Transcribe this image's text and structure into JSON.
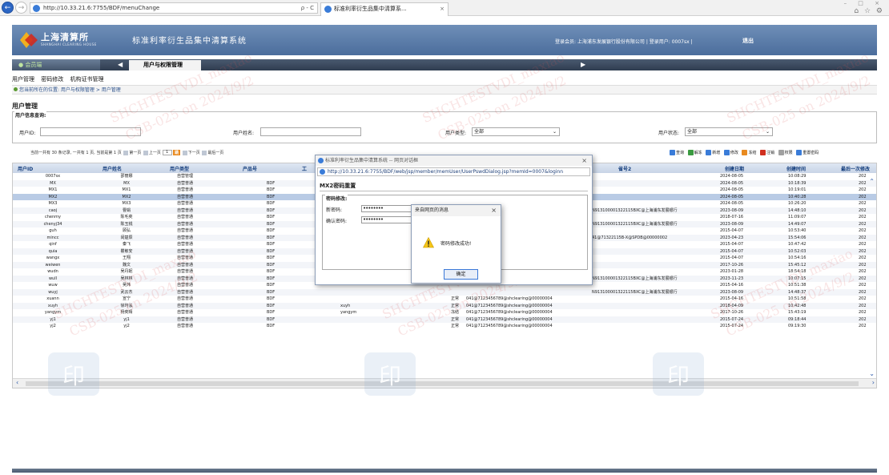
{
  "browser": {
    "url": "http://10.33.21.6:7755/BDF/menuChange",
    "address_tools": "ρ - C",
    "tab_title": "标准利率衍生品集中清算系...",
    "tab_close": "×",
    "back": "←",
    "forward": "→",
    "window_controls": "– □ ×",
    "toolbar_icons": "⌂ ☆ ⚙"
  },
  "header": {
    "logo_text": "上海清算所",
    "logo_sub": "SHANGHAI CLEARING HOUSE",
    "system_title": "标准利率衍生品集中清算系统",
    "login_info": "登录会员: 上海浦东发展银行股份有限公司 | 登录用户: 0007sx |",
    "logout": "退出"
  },
  "nav": {
    "member_label": "会员端",
    "toggle": "◀",
    "active_tab": "用户与权限管理",
    "arrow": "▶"
  },
  "menu": {
    "items": [
      "用户管理",
      "密码修改",
      "机构证书管理"
    ]
  },
  "breadcrumb": "您当前所在的位置: 用户与权限管理 > 用户管理",
  "page_title": "用户管理",
  "query": {
    "legend": "用户信息查询:",
    "user_id_label": "用户ID:",
    "user_name_label": "用户姓名:",
    "user_type_label": "用户类型:",
    "user_type_value": "全部",
    "user_status_label": "用户状态:",
    "user_status_value": "全部"
  },
  "pager": {
    "text_a": "当前一共有",
    "total": "30",
    "text_b": "条记录, 一共有",
    "pages": "1",
    "text_c": "页, 当前是第",
    "current": "1",
    "text_d": "页",
    "first": "第一页",
    "prev": "上一页",
    "page_input": "1",
    "go": "跳",
    "next": "下一页",
    "last": "最后一页"
  },
  "toolbar": {
    "items": [
      "查询",
      "解冻",
      "新增",
      "修改",
      "冻结",
      "注销",
      "权限",
      "重置密码"
    ],
    "colors": [
      "#3a7cd8",
      "#3a9a40",
      "#3a7cd8",
      "#3a7cd8",
      "#e88a20",
      "#d03020",
      "#a0a0a0",
      "#3a7cd8"
    ]
  },
  "table": {
    "headers": [
      "用户ID",
      "用户姓名",
      "用户类型",
      "产品号",
      "工",
      "省号2",
      "创建日期",
      "创建时间",
      "最后一次修改"
    ],
    "selected_index": 3,
    "rows": [
      {
        "id": "0007sx",
        "name": "邵丽娜",
        "type": "自营管理",
        "product": "",
        "col5": "",
        "status": "",
        "cert": "",
        "acct": "",
        "date": "2024-08-05",
        "time": "10:08:29",
        "last": "202"
      },
      {
        "id": "MX",
        "name": "MX",
        "type": "自营普通",
        "product": "BDF",
        "col5": "",
        "status": "",
        "cert": "",
        "acct": "",
        "date": "2024-08-05",
        "time": "10:18:39",
        "last": "202"
      },
      {
        "id": "MX1",
        "name": "MX1",
        "type": "自营普通",
        "product": "BDF",
        "col5": "",
        "status": "",
        "cert": "",
        "acct": "",
        "date": "2024-08-05",
        "time": "10:19:01",
        "last": "202"
      },
      {
        "id": "MX2",
        "name": "MX2",
        "type": "自营普通",
        "product": "BDF",
        "col5": "",
        "status": "",
        "cert": "",
        "acct": "",
        "date": "2024-08-05",
        "time": "10:40:28",
        "last": "202"
      },
      {
        "id": "MX3",
        "name": "MX3",
        "type": "自营普通",
        "product": "BDF",
        "col5": "",
        "status": "",
        "cert": "",
        "acct": "",
        "date": "2024-08-05",
        "time": "10:26:20",
        "last": "202"
      },
      {
        "id": "caoj",
        "name": "曹娟",
        "type": "自营普通",
        "product": "BDF",
        "col5": "",
        "status": "",
        "cert": "",
        "acct": "N913100001322115BXC@上海浦东发展银行",
        "date": "2023-08-09",
        "time": "14:48:10",
        "last": "202"
      },
      {
        "id": "chenmy",
        "name": "陈毛奕",
        "type": "自营普通",
        "product": "BDF",
        "col5": "",
        "status": "",
        "cert": "",
        "acct": "",
        "date": "2018-07-16",
        "time": "11:09:07",
        "last": "202"
      },
      {
        "id": "chenyj34",
        "name": "陈玉锐",
        "type": "自营普通",
        "product": "BDF",
        "col5": "",
        "status": "",
        "cert": "",
        "acct": "N913100001322115BXC@上海浦东发展银行",
        "date": "2023-08-09",
        "time": "14:49:07",
        "last": "202"
      },
      {
        "id": "guh",
        "name": "顾弘",
        "type": "自营普通",
        "product": "BDF",
        "col5": "",
        "status": "",
        "cert": "",
        "acct": "",
        "date": "2015-04-07",
        "time": "10:53:40",
        "last": "202"
      },
      {
        "id": "mincc",
        "name": "闵楚辰",
        "type": "自营普通",
        "product": "BDF",
        "col5": "",
        "status": "",
        "cert": "",
        "acct": "41@71322115B-X@SPDB@00000002",
        "date": "2023-04-23",
        "time": "15:54:06",
        "last": "202"
      },
      {
        "id": "qinf",
        "name": "秦飞",
        "type": "自营普通",
        "product": "BDF",
        "col5": "",
        "status": "",
        "cert": "",
        "acct": "",
        "date": "2015-04-07",
        "time": "10:47:42",
        "last": "202"
      },
      {
        "id": "quia",
        "name": "瞿敏安",
        "type": "自营普通",
        "product": "BDF",
        "col5": "",
        "status": "",
        "cert": "",
        "acct": "",
        "date": "2015-04-07",
        "time": "10:52:03",
        "last": "202"
      },
      {
        "id": "wangx",
        "name": "王翔",
        "type": "自营普通",
        "product": "BDF",
        "col5": "",
        "status": "",
        "cert": "",
        "acct": "",
        "date": "2015-04-07",
        "time": "10:54:16",
        "last": "202"
      },
      {
        "id": "weiwen",
        "name": "魏文",
        "type": "自营普通",
        "product": "BDF",
        "col5": "",
        "status": "",
        "cert": "",
        "acct": "",
        "date": "2017-10-26",
        "time": "15:45:12",
        "last": "202"
      },
      {
        "id": "wudn",
        "name": "吴丹妮",
        "type": "自营普通",
        "product": "BDF",
        "col5": "",
        "status": "",
        "cert": "",
        "acct": "",
        "date": "2023-01-28",
        "time": "18:54:18",
        "last": "202"
      },
      {
        "id": "wull",
        "name": "吴林林",
        "type": "自营普通",
        "product": "BDF",
        "col5": "",
        "status": "",
        "cert": "",
        "acct": "N913100001322115BXC@上海浦东发展银行",
        "date": "2023-11-23",
        "time": "10:07:15",
        "last": "202"
      },
      {
        "id": "wuw",
        "name": "吴炜",
        "type": "自营普通",
        "product": "BDF",
        "col5": "",
        "status": "",
        "cert": "",
        "acct": "",
        "date": "2015-04-16",
        "time": "10:51:38",
        "last": "202"
      },
      {
        "id": "wuyj",
        "name": "武云杰",
        "type": "自营普通",
        "product": "BDF",
        "col5": "",
        "status": "",
        "cert": "",
        "acct": "N913100001322115BXC@上海浦东发展银行",
        "date": "2023-08-09",
        "time": "14:48:37",
        "last": "202"
      },
      {
        "id": "xuann",
        "name": "宣宁",
        "type": "自营普通",
        "product": "BDF",
        "col5": "",
        "status": "正常",
        "cert": "041@7123456789@shclearing@00000004",
        "acct": "",
        "date": "2015-04-16",
        "time": "10:51:58",
        "last": "202"
      },
      {
        "id": "xuyh",
        "name": "徐玙泓",
        "type": "自营普通",
        "product": "BDF",
        "col5": "xuyh",
        "status": "正常",
        "cert": "041@7123456789@shclearing@00000004",
        "acct": "",
        "date": "2018-04-09",
        "time": "10:42:48",
        "last": "202"
      },
      {
        "id": "yangym",
        "name": "杨奕晴",
        "type": "自营普通",
        "product": "BDF",
        "col5": "yangym",
        "status": "冻结",
        "cert": "041@7123456789@shclearing@00000004",
        "acct": "",
        "date": "2017-10-26",
        "time": "15:43:19",
        "last": "202"
      },
      {
        "id": "yj1",
        "name": "yj1",
        "type": "自营普通",
        "product": "BDF",
        "col5": "",
        "status": "正常",
        "cert": "041@7123456789@shclearing@00000004",
        "acct": "",
        "date": "2015-07-24",
        "time": "09:18:44",
        "last": "202"
      },
      {
        "id": "yj2",
        "name": "yj2",
        "type": "自营普通",
        "product": "BDF",
        "col5": "",
        "status": "正常",
        "cert": "041@7123456789@shclearing@00000004",
        "acct": "",
        "date": "2015-07-24",
        "time": "09:19:30",
        "last": "202"
      }
    ]
  },
  "dialog": {
    "title": "标准利率衍生品集中清算系统 -- 网页对话框",
    "close": "×",
    "url": "http://10.33.21.6:7755/BDF/web/jsp/member/memUser/UserPswdDialog.jsp?memId=0007&loginn",
    "inner_title": "MX2密码重置",
    "legend": "密码修改:",
    "new_pwd_label": "新密码:",
    "confirm_pwd_label": "确认密码:",
    "new_pwd_value": "••••••••",
    "confirm_pwd_value": "••••••••"
  },
  "alert": {
    "title": "来自网页的消息",
    "close": "×",
    "message": "密码修改成功!",
    "ok": "确定"
  },
  "watermark": {
    "lines": [
      "SHCHTESTVDI_maxiao",
      "CSB-025 on 2024/9/2"
    ],
    "seal_glyph": "印"
  }
}
